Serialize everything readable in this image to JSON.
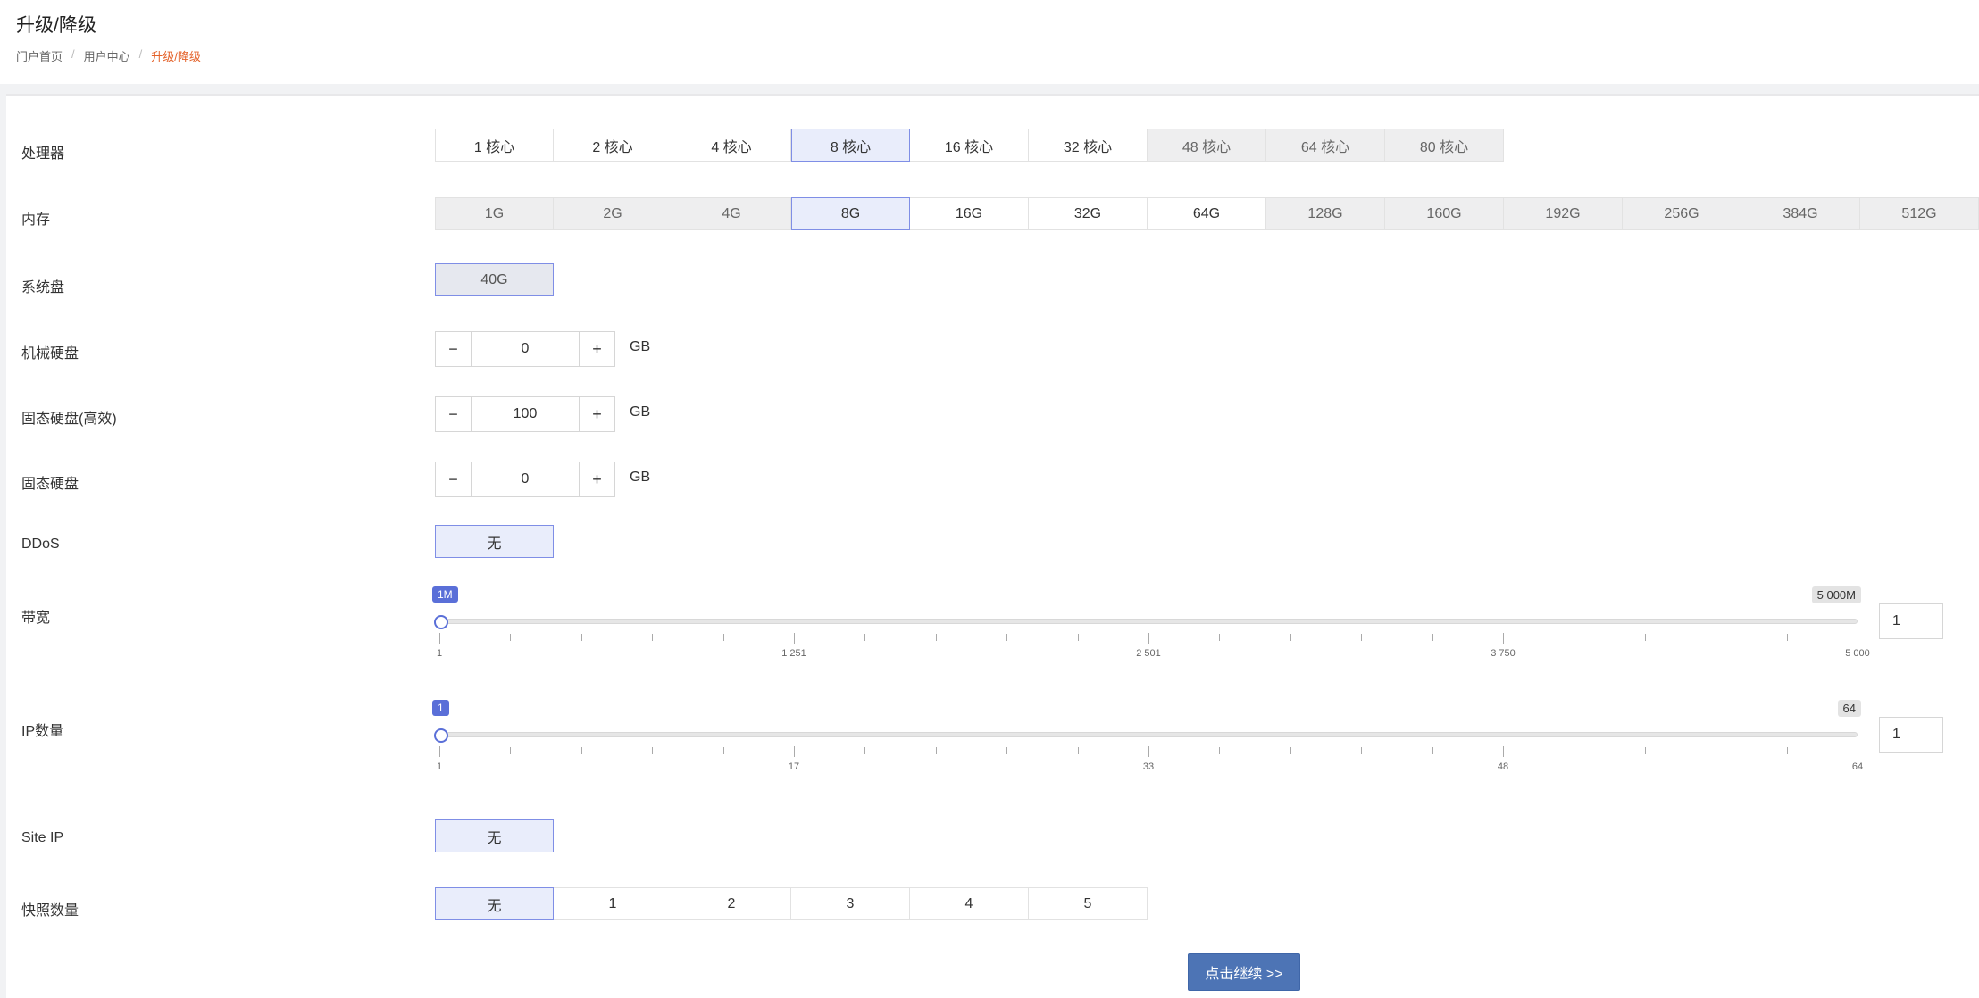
{
  "header": {
    "title": "升级/降级",
    "breadcrumb": [
      "门户首页",
      "用户中心",
      "升级/降级"
    ],
    "breadcrumb_sep": "/"
  },
  "rows": {
    "cpu": {
      "label": "处理器",
      "options": [
        "1 核心",
        "2 核心",
        "4 核心",
        "8 核心",
        "16 核心",
        "32 核心",
        "48 核心",
        "64 核心",
        "80 核心"
      ],
      "selected": "8 核心"
    },
    "memory": {
      "label": "内存",
      "options": [
        "1G",
        "2G",
        "4G",
        "8G",
        "16G",
        "32G",
        "64G",
        "128G",
        "160G",
        "192G",
        "256G",
        "384G",
        "512G"
      ],
      "selected": "8G"
    },
    "system_disk": {
      "label": "系统盘",
      "options": [
        "40G"
      ],
      "selected": "40G"
    },
    "hdd": {
      "label": "机械硬盘",
      "minus": "−",
      "plus": "+",
      "value": "0",
      "unit": "GB"
    },
    "ssd_fast": {
      "label": "固态硬盘(高效)",
      "minus": "−",
      "plus": "+",
      "value": "100",
      "unit": "GB"
    },
    "ssd": {
      "label": "固态硬盘",
      "minus": "−",
      "plus": "+",
      "value": "0",
      "unit": "GB"
    },
    "ddos": {
      "label": "DDoS",
      "options": [
        "无"
      ],
      "selected": "无"
    },
    "bandwidth": {
      "label": "带宽",
      "min_tag": "1M",
      "max_tag": "5 000M",
      "ticks": [
        "1",
        "1 251",
        "2 501",
        "3 750",
        "5 000"
      ],
      "value": "1",
      "min": 1,
      "max": 5000,
      "current": 1
    },
    "ip_count": {
      "label": "IP数量",
      "min_tag": "1",
      "max_tag": "64",
      "ticks": [
        "1",
        "17",
        "33",
        "48",
        "64"
      ],
      "value": "1",
      "min": 1,
      "max": 64,
      "current": 1
    },
    "site_ip": {
      "label": "Site IP",
      "options": [
        "无"
      ],
      "selected": "无"
    },
    "snapshots": {
      "label": "快照数量",
      "options": [
        "无",
        "1",
        "2",
        "3",
        "4",
        "5"
      ],
      "selected": "无"
    }
  },
  "continue_label": "点击继续 >>",
  "colors": {
    "accent": "#5a6fd8",
    "breadcrumb_active": "#e4622a",
    "button": "#4d74b5"
  }
}
